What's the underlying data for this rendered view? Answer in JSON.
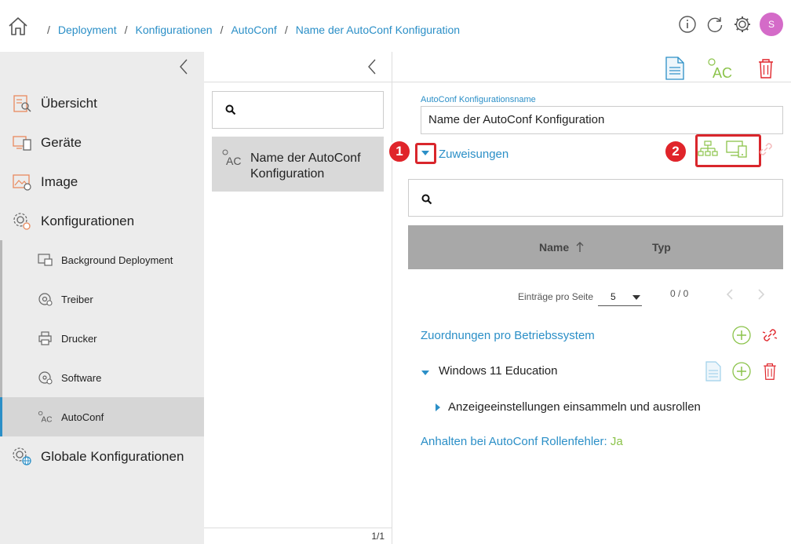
{
  "breadcrumb": {
    "items": [
      "Deployment",
      "Konfigurationen",
      "AutoConf",
      "Name der AutoConf Konfiguration"
    ],
    "separator": "/"
  },
  "header": {
    "icons": [
      "home-icon",
      "info-icon",
      "refresh-icon",
      "settings-gear-icon"
    ],
    "avatar_initial": "S",
    "avatar_color": "#d46bc8"
  },
  "sidebar": {
    "items": [
      {
        "label": "Übersicht",
        "icon": "overview-icon"
      },
      {
        "label": "Geräte",
        "icon": "devices-icon"
      },
      {
        "label": "Image",
        "icon": "image-icon"
      },
      {
        "label": "Konfigurationen",
        "icon": "configurations-icon"
      }
    ],
    "sub_items": [
      {
        "label": "Background Deployment",
        "icon": "background-deployment-icon"
      },
      {
        "label": "Treiber",
        "icon": "driver-icon"
      },
      {
        "label": "Drucker",
        "icon": "printer-icon"
      },
      {
        "label": "Software",
        "icon": "software-icon"
      },
      {
        "label": "AutoConf",
        "icon": "autoconf-icon",
        "active": true
      }
    ],
    "bottom_item": {
      "label": "Globale Konfigurationen",
      "icon": "global-config-icon"
    }
  },
  "middle": {
    "search_placeholder": "",
    "selected_item": "Name der AutoConf Konfiguration",
    "footer_pagination": "1/1"
  },
  "detail": {
    "field_label": "AutoConf Konfigurationsname",
    "field_value": "Name der AutoConf Konfiguration",
    "assignments_label": "Zuweisungen",
    "callout_1": "1",
    "callout_2": "2",
    "table": {
      "columns": [
        "Name",
        "Typ"
      ],
      "rows": []
    },
    "pager": {
      "per_page_label": "Einträge pro Seite",
      "per_page_value": "5",
      "count": "0 / 0"
    },
    "os_section_title": "Zuordnungen pro Betriebssystem",
    "os_entry": "Windows 11 Education",
    "role_entry": "Anzeigeeinstellungen einsammeln und ausrollen",
    "halt_label": "Anhalten bei AutoConf Rollenfehler:",
    "halt_value": "Ja"
  },
  "colors": {
    "accent_blue": "#2b8fc7",
    "accent_green": "#8bc34a",
    "danger_red": "#e0242a",
    "sidebar_bg": "#ececec",
    "table_header_bg": "#a8a8a8"
  }
}
